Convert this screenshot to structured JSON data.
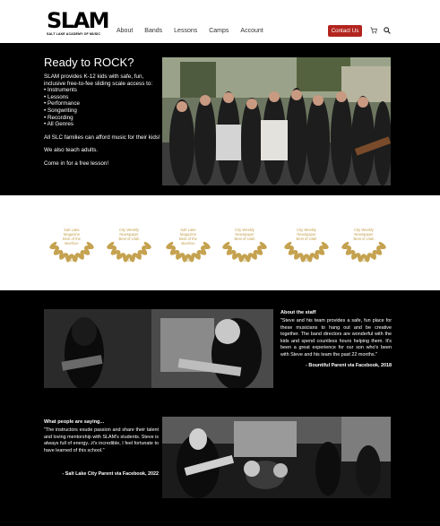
{
  "header": {
    "logo_text": "SLAM",
    "logo_subtitle": "SALT LAKE ACADEMY OF MUSIC",
    "nav": [
      "About",
      "Bands",
      "Lessons",
      "Camps",
      "Account"
    ],
    "contact_label": "Contact Us",
    "cart_icon": "cart-icon",
    "search_icon": "search-icon",
    "accent_color": "#b3241e"
  },
  "hero": {
    "title": "Ready to ROCK?",
    "intro": "SLAM provides K-12 kids with safe, fun, inclusive free-to-fee sliding scale access to:",
    "items": [
      "• Instruments",
      "• Lessons",
      "• Performance",
      "• Songwriting",
      "• Recording",
      "• All Genres"
    ],
    "p1": "All SLC families can afford music for their kids!",
    "p2": "We also teach adults.",
    "p3": "Come in for a free lesson!"
  },
  "awards": [
    {
      "line1": "Salt Lake",
      "line2": "Magazine",
      "line3": "Best of the",
      "line4": "Beehive",
      "year": "2016"
    },
    {
      "line1": "City Weekly",
      "line2": "Newspaper",
      "line3": "Best of Utah",
      "line4": "",
      "year": "2016"
    },
    {
      "line1": "Salt Lake",
      "line2": "Magazine",
      "line3": "Best of the",
      "line4": "Beehive",
      "year": "2008"
    },
    {
      "line1": "City Weekly",
      "line2": "Newspaper",
      "line3": "Best of Utah",
      "line4": "",
      "year": "2007"
    },
    {
      "line1": "City Weekly",
      "line2": "Newspaper",
      "line3": "Best of Utah",
      "line4": "",
      "year": "2006"
    },
    {
      "line1": "City Weekly",
      "line2": "Newspaper",
      "line3": "Best of Utah",
      "line4": "",
      "year": "2005"
    }
  ],
  "award_color": "#c5a250",
  "staff": {
    "heading": "About the staff",
    "quote": "\"Steve and his team provides a safe, fun place for these musicians to hang out and be creative together. The band directors are wonderful with the kids and spend countless hours helping them. It's been a great experience for our son who's been with Steve and his team the past 22 months.\"",
    "attribution": "- Bountiful Parent via Facebook, 2018"
  },
  "people": {
    "heading": "What people are saying...",
    "quote": "\"The instructors exude passion and share their talent and loving mentorship with SLAM's students. Steve is always full of energy...it's incredible, I feel fortunate to have learned of this school.\"",
    "attribution": "- Salt Lake City Parent via Facebook, 2022"
  }
}
